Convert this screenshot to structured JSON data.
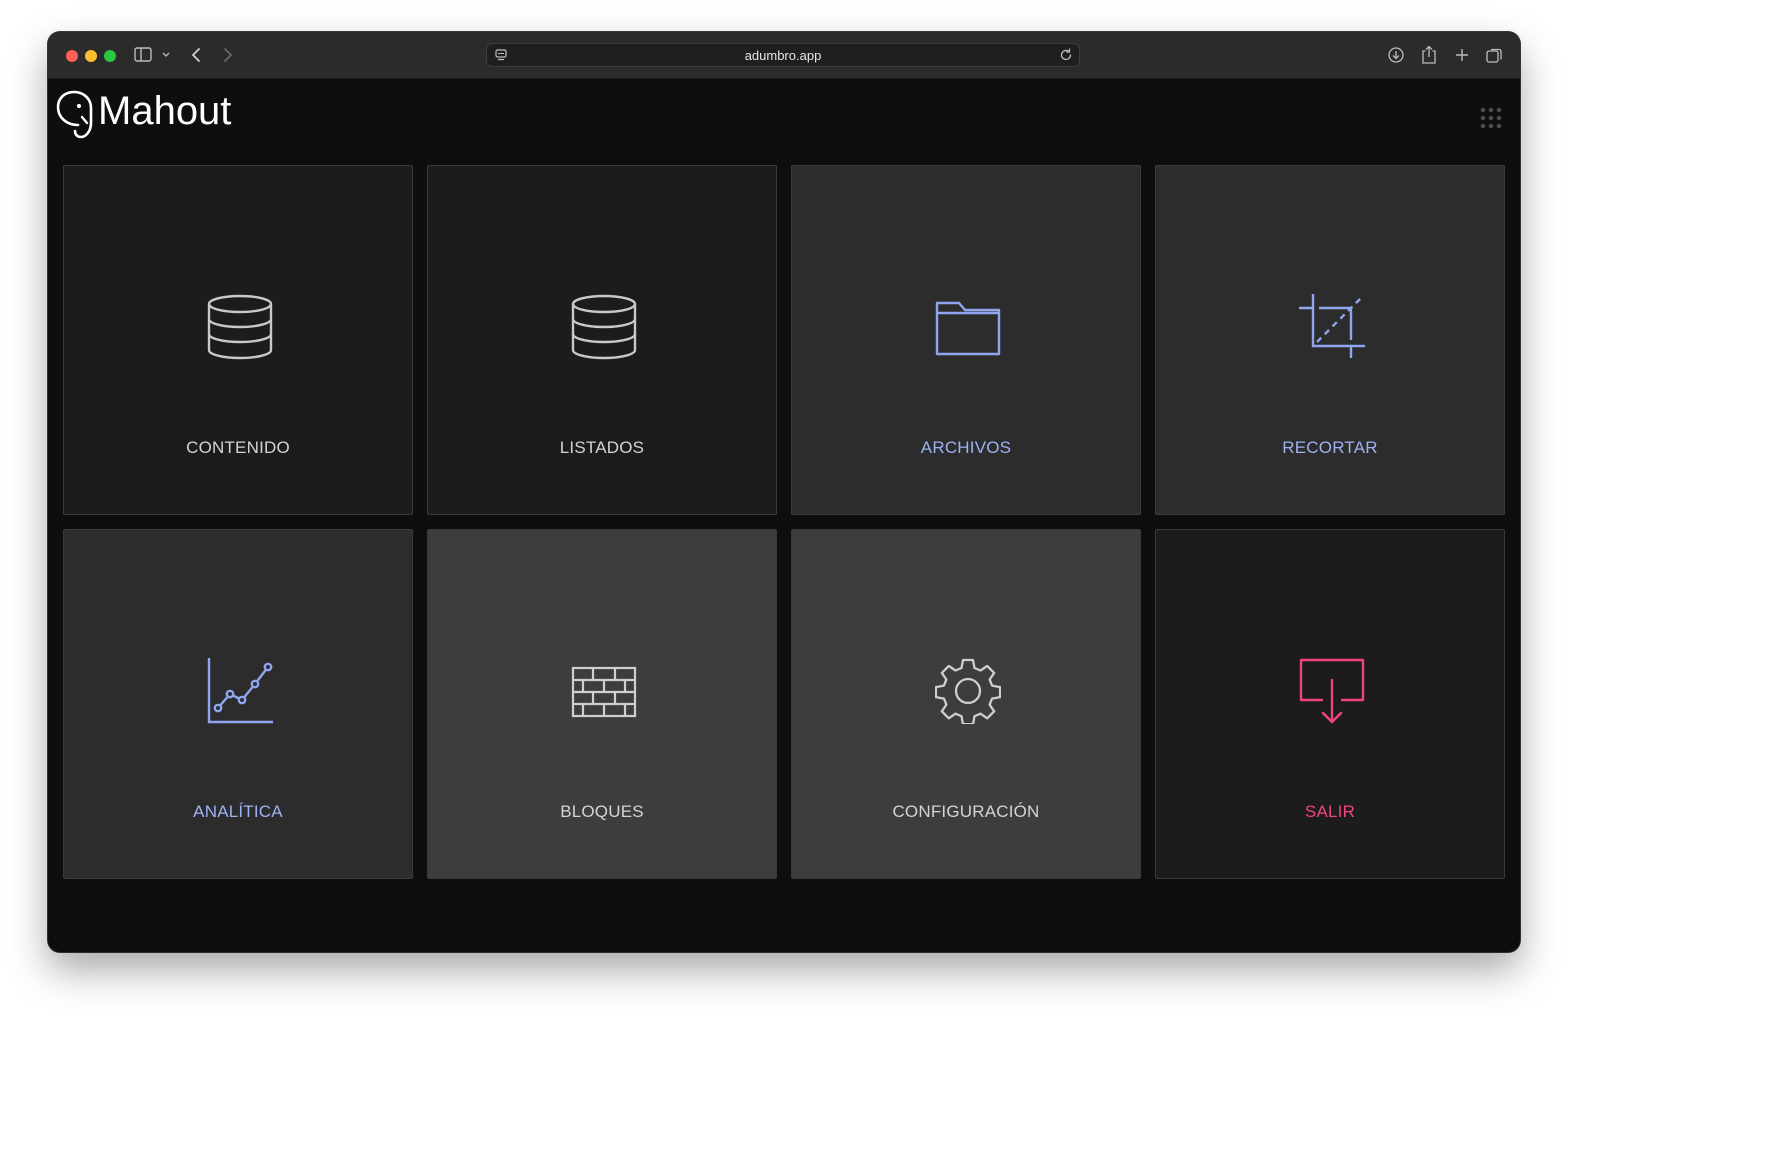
{
  "browser": {
    "url": "adumbro.app"
  },
  "app": {
    "logo_text": "Mahout"
  },
  "colors": {
    "accent_blue": "#9db2f2",
    "gray_text": "#d4d4d4",
    "exit_red": "#f0457a"
  },
  "tiles": [
    {
      "label": "CONTENIDO",
      "icon": "database-icon"
    },
    {
      "label": "LISTADOS",
      "icon": "database-icon"
    },
    {
      "label": "ARCHIVOS",
      "icon": "folder-icon"
    },
    {
      "label": "RECORTAR",
      "icon": "crop-icon"
    },
    {
      "label": "ANALÍTICA",
      "icon": "line-chart-icon"
    },
    {
      "label": "BLOQUES",
      "icon": "brick-wall-icon"
    },
    {
      "label": "CONFIGURACIÓN",
      "icon": "gear-icon"
    },
    {
      "label": "SALIR",
      "icon": "logout-icon"
    }
  ]
}
